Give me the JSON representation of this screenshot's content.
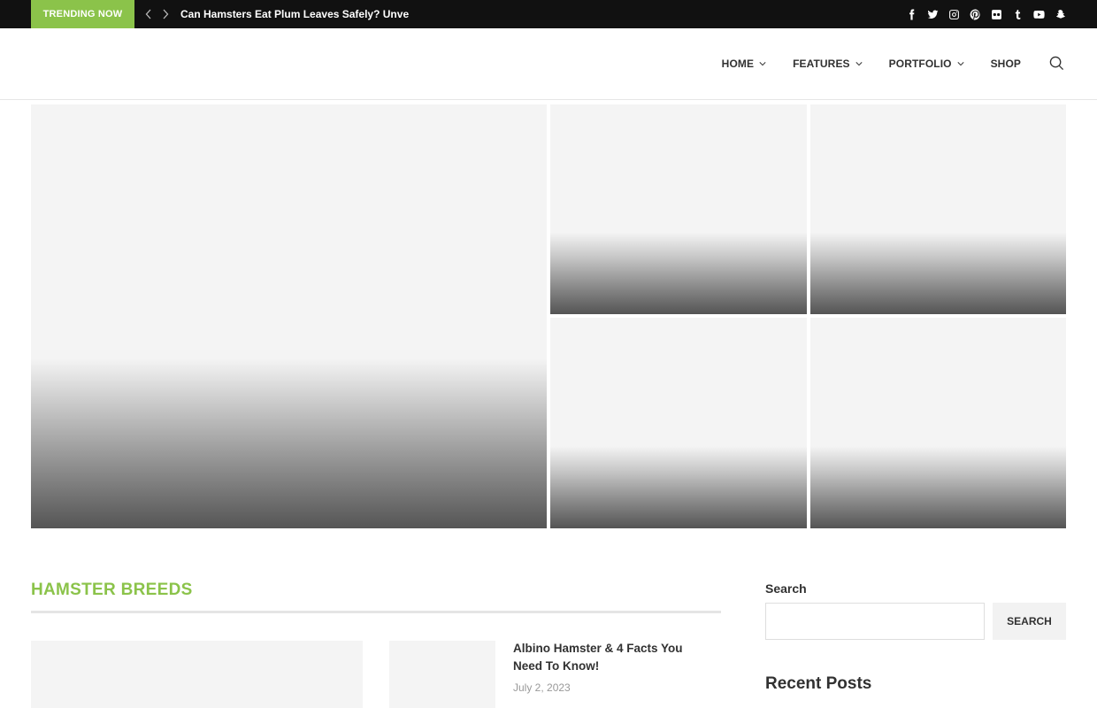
{
  "topbar": {
    "trending_label": "Trending Now",
    "trending_title": "Can Hamsters Eat Plum Leaves Safely? Unve",
    "prev_icon": "chevron-left-icon",
    "next_icon": "chevron-right-icon",
    "socials": [
      "facebook-icon",
      "twitter-icon",
      "instagram-icon",
      "pinterest-icon",
      "flickr-icon",
      "tumblr-icon",
      "youtube-icon",
      "snapchat-icon"
    ]
  },
  "header": {
    "menu": [
      {
        "label": "Home",
        "has_dropdown": true
      },
      {
        "label": "Features",
        "has_dropdown": true
      },
      {
        "label": "Portfolio",
        "has_dropdown": true
      },
      {
        "label": "Shop",
        "has_dropdown": false
      }
    ],
    "search_icon": "search-icon"
  },
  "section": {
    "title": "Hamster Breeds"
  },
  "posts": [
    {
      "title": "Albino Hamster & 4 Facts You Need To Know!",
      "date": "July 2, 2023"
    }
  ],
  "sidebar": {
    "search_label": "Search",
    "search_placeholder": "",
    "search_button": "Search",
    "recent_heading": "Recent Posts"
  },
  "colors": {
    "accent": "#8bc34a",
    "topbar_bg": "#111111",
    "placeholder_bg": "#f4f4f4"
  }
}
